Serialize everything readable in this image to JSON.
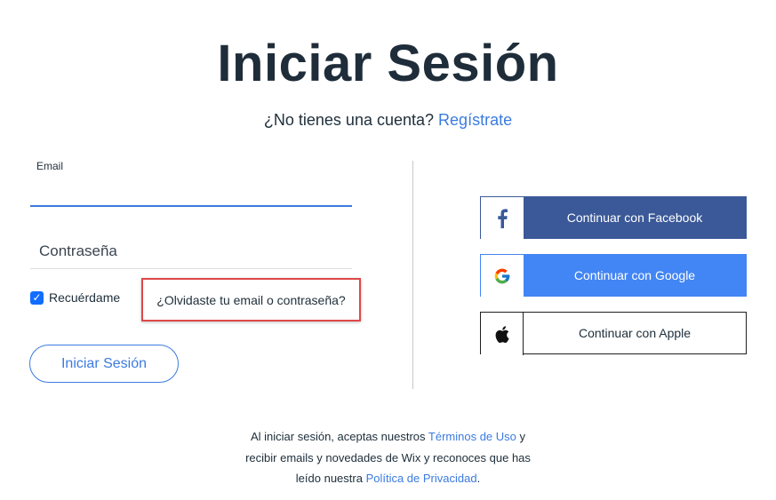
{
  "heading": "Iniciar Sesión",
  "signup": {
    "prompt": "¿No tienes una cuenta?",
    "link": "Regístrate"
  },
  "form": {
    "email_label": "Email",
    "email_value": "",
    "password_placeholder": "Contraseña",
    "remember_label": "Recuérdame",
    "remember_checked": true,
    "forgot_link": "¿Olvidaste tu email o contraseña?",
    "submit_label": "Iniciar Sesión"
  },
  "social": {
    "facebook_label": "Continuar con Facebook",
    "google_label": "Continuar con Google",
    "apple_label": "Continuar con Apple"
  },
  "footer": {
    "line1_pre": "Al iniciar sesión, aceptas nuestros ",
    "terms_link": "Términos de Uso",
    "line1_post": " y",
    "line2": "recibir emails y novedades de Wix y reconoces que has",
    "line3_pre": "leído nuestra ",
    "privacy_link": "Política de Privacidad",
    "line3_post": "."
  },
  "colors": {
    "accent": "#3b7be0",
    "facebook": "#3b5998",
    "google": "#4285f4",
    "highlight": "#e04848"
  },
  "icons": [
    "facebook-icon",
    "google-icon",
    "apple-icon",
    "checkmark-icon"
  ]
}
